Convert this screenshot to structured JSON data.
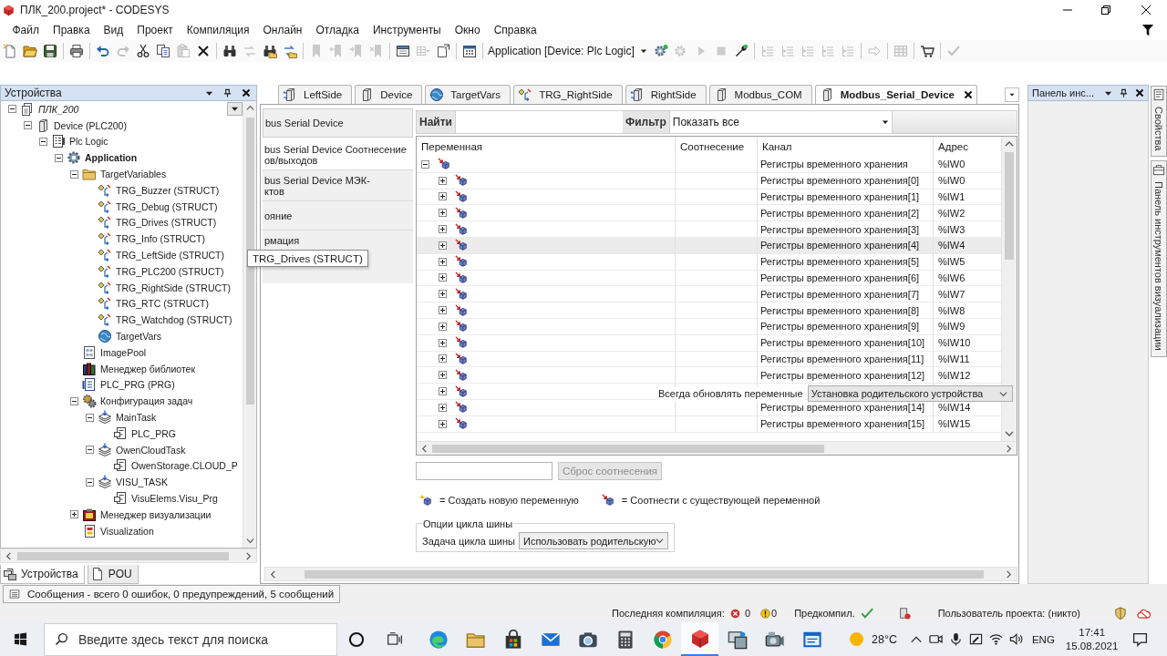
{
  "window": {
    "title": "ПЛК_200.project* - CODESYS"
  },
  "menu": [
    "Файл",
    "Правка",
    "Вид",
    "Проект",
    "Компиляция",
    "Онлайн",
    "Отладка",
    "Инструменты",
    "Окно",
    "Справка"
  ],
  "toolbar": {
    "groups": [
      [
        {
          "kind": "new",
          "disabled": false
        },
        {
          "kind": "open",
          "disabled": false
        },
        {
          "kind": "save",
          "disabled": false
        }
      ],
      [
        {
          "kind": "print",
          "disabled": false
        }
      ],
      [
        {
          "kind": "undo",
          "disabled": false
        },
        {
          "kind": "redo",
          "disabled": true
        },
        {
          "kind": "cut",
          "disabled": false
        },
        {
          "kind": "copy",
          "disabled": false
        },
        {
          "kind": "paste",
          "disabled": true
        },
        {
          "kind": "delete",
          "disabled": false
        }
      ],
      [
        {
          "kind": "find",
          "disabled": false
        },
        {
          "kind": "replace",
          "disabled": true
        },
        {
          "kind": "find_project",
          "disabled": false
        },
        {
          "kind": "replace_project",
          "disabled": false
        }
      ],
      [
        {
          "kind": "bookmark",
          "disabled": true
        },
        {
          "kind": "bookmark_prev",
          "disabled": true
        },
        {
          "kind": "bookmark_next",
          "disabled": true
        },
        {
          "kind": "bookmark_clear",
          "disabled": true
        }
      ],
      [
        {
          "kind": "window",
          "disabled": false
        },
        {
          "kind": "table_menu",
          "disabled": true
        },
        {
          "kind": "page",
          "disabled": false
        }
      ],
      [
        {
          "kind": "calendar",
          "disabled": false
        }
      ],
      [
        {
          "kind": "combo",
          "value": "Application [Device: Plc Logic]"
        },
        {
          "kind": "login",
          "disabled": false
        },
        {
          "kind": "logout",
          "disabled": true
        },
        {
          "kind": "run",
          "disabled": true
        },
        {
          "kind": "stop",
          "disabled": true
        },
        {
          "kind": "wrench",
          "disabled": false
        }
      ],
      [
        {
          "kind": "step",
          "disabled": true
        },
        {
          "kind": "step",
          "disabled": true
        },
        {
          "kind": "step",
          "disabled": true
        },
        {
          "kind": "step",
          "disabled": true
        },
        {
          "kind": "step",
          "disabled": true
        }
      ],
      [
        {
          "kind": "jump",
          "disabled": true
        }
      ],
      [
        {
          "kind": "grid",
          "disabled": true
        }
      ],
      [
        {
          "kind": "cart",
          "disabled": false
        }
      ],
      [
        {
          "kind": "check",
          "disabled": true
        }
      ]
    ]
  },
  "devices_panel": {
    "title": "Устройства",
    "tree": [
      {
        "label": "ПЛК_200",
        "kind": "project",
        "expanded": true,
        "children": [
          {
            "label": "Device (PLC200)",
            "kind": "device",
            "expanded": true,
            "children": [
              {
                "label": "Plc Logic",
                "kind": "plc",
                "expanded": true,
                "children": [
                  {
                    "label": "Application",
                    "kind": "application",
                    "expanded": true,
                    "children": [
                      {
                        "label": "TargetVariables",
                        "kind": "folder",
                        "expanded": true,
                        "children": [
                          {
                            "label": "TRG_Buzzer (STRUCT)",
                            "kind": "struct"
                          },
                          {
                            "label": "TRG_Debug (STRUCT)",
                            "kind": "struct"
                          },
                          {
                            "label": "TRG_Drives (STRUCT)",
                            "kind": "struct"
                          },
                          {
                            "label": "TRG_Info (STRUCT)",
                            "kind": "struct"
                          },
                          {
                            "label": "TRG_LeftSide (STRUCT)",
                            "kind": "struct"
                          },
                          {
                            "label": "TRG_PLC200 (STRUCT)",
                            "kind": "struct"
                          },
                          {
                            "label": "TRG_RightSide (STRUCT)",
                            "kind": "struct"
                          },
                          {
                            "label": "TRG_RTC (STRUCT)",
                            "kind": "struct"
                          },
                          {
                            "label": "TRG_Watchdog (STRUCT)",
                            "kind": "struct"
                          },
                          {
                            "label": "TargetVars",
                            "kind": "globals"
                          }
                        ]
                      },
                      {
                        "label": "ImagePool",
                        "kind": "imagepool"
                      },
                      {
                        "label": "Менеджер библиотек",
                        "kind": "library"
                      },
                      {
                        "label": "PLC_PRG (PRG)",
                        "kind": "program"
                      },
                      {
                        "label": "Конфигурация задач",
                        "kind": "taskconfig",
                        "expanded": true,
                        "children": [
                          {
                            "label": "MainTask",
                            "kind": "task",
                            "expanded": true,
                            "children": [
                              {
                                "label": "PLC_PRG",
                                "kind": "call"
                              }
                            ]
                          },
                          {
                            "label": "OwenCloudTask",
                            "kind": "task",
                            "expanded": true,
                            "children": [
                              {
                                "label": "OwenStorage.CLOUD_P",
                                "kind": "call"
                              }
                            ]
                          },
                          {
                            "label": "VISU_TASK",
                            "kind": "task",
                            "expanded": true,
                            "children": [
                              {
                                "label": "VisuElems.Visu_Prg",
                                "kind": "call"
                              }
                            ]
                          }
                        ]
                      },
                      {
                        "label": "Менеджер визуализации",
                        "kind": "visumanager",
                        "expanded": false
                      },
                      {
                        "label": "Visualization",
                        "kind": "visualization"
                      }
                    ]
                  }
                ]
              }
            ]
          }
        ]
      }
    ],
    "tabs": [
      {
        "label": "Устройства",
        "kind": "devices",
        "selected": true
      },
      {
        "label": "POU",
        "kind": "pou",
        "selected": false
      }
    ]
  },
  "tooltip": "TRG_Drives (STRUCT)",
  "editor": {
    "tabs": [
      {
        "label": "LeftSide",
        "kind": "io",
        "selected": false
      },
      {
        "label": "Device",
        "kind": "device",
        "selected": false
      },
      {
        "label": "TargetVars",
        "kind": "globals",
        "selected": false
      },
      {
        "label": "TRG_RightSide",
        "kind": "struct",
        "selected": false
      },
      {
        "label": "RightSide",
        "kind": "io",
        "selected": false
      },
      {
        "label": "Modbus_COM",
        "kind": "device",
        "selected": false
      },
      {
        "label": "Modbus_Serial_Device",
        "kind": "device",
        "selected": true
      }
    ],
    "sections": [
      {
        "lines": [
          "bus Serial Device"
        ],
        "selected": false
      },
      {
        "lines": [
          "bus Serial Device Соотнесение",
          "ов/выходов"
        ],
        "selected": true
      },
      {
        "lines": [
          "bus Serial Device МЭК-",
          "ктов"
        ],
        "selected": false
      },
      {
        "lines": [
          "ояние"
        ],
        "selected": false
      },
      {
        "lines": [
          "рмация"
        ],
        "selected": false
      }
    ],
    "search": {
      "label": "Найти",
      "filter_label": "Фильтр",
      "filter_value": "Показать все"
    },
    "table": {
      "columns": [
        "Переменная",
        "Соотнесение",
        "Канал",
        "Адрес"
      ],
      "rows": [
        {
          "expanded": true,
          "selected": false,
          "channel": "Регистры временного хранения",
          "address": "%IW0",
          "children": [
            {
              "expanded": false,
              "selected": false,
              "channel": "Регистры временного хранения[0]",
              "address": "%IW0"
            },
            {
              "expanded": false,
              "selected": false,
              "channel": "Регистры временного хранения[1]",
              "address": "%IW1"
            },
            {
              "expanded": false,
              "selected": false,
              "channel": "Регистры временного хранения[2]",
              "address": "%IW2"
            },
            {
              "expanded": false,
              "selected": false,
              "channel": "Регистры временного хранения[3]",
              "address": "%IW3"
            },
            {
              "expanded": false,
              "selected": true,
              "channel": "Регистры временного хранения[4]",
              "address": "%IW4"
            },
            {
              "expanded": false,
              "selected": false,
              "channel": "Регистры временного хранения[5]",
              "address": "%IW5"
            },
            {
              "expanded": false,
              "selected": false,
              "channel": "Регистры временного хранения[6]",
              "address": "%IW6"
            },
            {
              "expanded": false,
              "selected": false,
              "channel": "Регистры временного хранения[7]",
              "address": "%IW7"
            },
            {
              "expanded": false,
              "selected": false,
              "channel": "Регистры временного хранения[8]",
              "address": "%IW8"
            },
            {
              "expanded": false,
              "selected": false,
              "channel": "Регистры временного хранения[9]",
              "address": "%IW9"
            },
            {
              "expanded": false,
              "selected": false,
              "channel": "Регистры временного хранения[10]",
              "address": "%IW10"
            },
            {
              "expanded": false,
              "selected": false,
              "channel": "Регистры временного хранения[11]",
              "address": "%IW11"
            },
            {
              "expanded": false,
              "selected": false,
              "channel": "Регистры временного хранения[12]",
              "address": "%IW12"
            },
            {
              "expanded": false,
              "selected": false
            },
            {
              "expanded": false,
              "selected": false,
              "channel": "Регистры временного хранения[14]",
              "address": "%IW14"
            },
            {
              "expanded": false,
              "selected": false,
              "channel": "Регистры временного хранения[15]",
              "address": "%IW15"
            }
          ]
        }
      ]
    },
    "overlay": {
      "label": "Всегда обновлять переменные",
      "value": "Установка родительского устройства"
    },
    "reset_button": {
      "label": "Сброс соотнесения",
      "disabled": true
    },
    "legend": [
      {
        "kind": "new",
        "text": "= Создать новую переменную"
      },
      {
        "kind": "existing",
        "text": "= Соотнести с существующей переменной"
      }
    ],
    "bus_cycle": {
      "title": "Опции цикла шины",
      "label": "Задача цикла шины",
      "value": "Использовать родительскую"
    }
  },
  "toolbox_panel": {
    "title": "Панель инс..."
  },
  "side_tabs": [
    {
      "label": "Свойства",
      "kind": "properties"
    },
    {
      "label": "Панель инструментов визуализации",
      "kind": "toolbox"
    }
  ],
  "messages": "Сообщения - всего 0 ошибок, 0 предупреждений, 5 сообщений",
  "status_bar": {
    "last_build_label": "Последняя компиляция:",
    "errors": "0",
    "warnings": "0",
    "precompile": "Предкомпил.",
    "user": "Пользователь проекта: (никто)"
  },
  "taskbar": {
    "search_placeholder": "Введите здесь текст для поиска",
    "items": [
      {
        "kind": "cortana",
        "active": false
      },
      {
        "kind": "taskview",
        "active": false
      },
      {
        "kind": "edge",
        "active": false
      },
      {
        "kind": "explorer",
        "active": false
      },
      {
        "kind": "store",
        "active": false
      },
      {
        "kind": "mail",
        "active": false
      },
      {
        "kind": "camera",
        "active": false
      },
      {
        "kind": "calculator",
        "active": false
      },
      {
        "kind": "chrome",
        "active": false
      },
      {
        "kind": "codesys",
        "active": true
      },
      {
        "kind": "app_monitor",
        "active": false
      },
      {
        "kind": "app_projector",
        "active": false
      },
      {
        "kind": "app_window",
        "active": false
      }
    ],
    "weather": "28°C",
    "language": "ENG",
    "time": "17:41",
    "date": "15.08.2021"
  }
}
